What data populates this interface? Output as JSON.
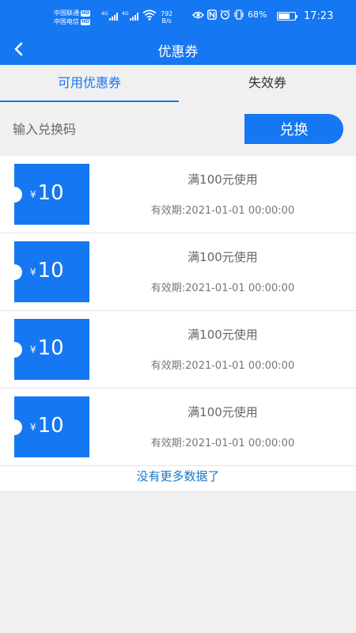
{
  "status_bar": {
    "carrier1": "中国联通",
    "carrier2": "中国电信",
    "hd_label": "HD",
    "network1": "4G",
    "network2": "4G",
    "speed_value": "792",
    "speed_unit": "B/s",
    "battery_text": "68%",
    "battery_level": 0.68,
    "time": "17:23",
    "icons": [
      "eye-icon",
      "nfc-icon",
      "alarm-icon",
      "vibrate-icon",
      "wifi-icon",
      "signal-icon",
      "battery-icon"
    ]
  },
  "header": {
    "title": "优惠券",
    "back_icon": "chevron-left-icon"
  },
  "tabs": [
    {
      "label": "可用优惠券",
      "active": true
    },
    {
      "label": "失效券",
      "active": false
    }
  ],
  "redeem": {
    "placeholder": "输入兑换码",
    "button_label": "兑换"
  },
  "coupons": [
    {
      "currency": "¥",
      "amount": "10",
      "condition": "满100元使用",
      "validity": "有效期:2021-01-01 00:00:00"
    },
    {
      "currency": "¥",
      "amount": "10",
      "condition": "满100元使用",
      "validity": "有效期:2021-01-01 00:00:00"
    },
    {
      "currency": "¥",
      "amount": "10",
      "condition": "满100元使用",
      "validity": "有效期:2021-01-01 00:00:00"
    },
    {
      "currency": "¥",
      "amount": "10",
      "condition": "满100元使用",
      "validity": "有效期:2021-01-01 00:00:00"
    }
  ],
  "footer_text": "没有更多数据了",
  "colors": {
    "primary": "#1677f2",
    "background": "#f0f0f0",
    "footer_link": "#1a75c8"
  }
}
